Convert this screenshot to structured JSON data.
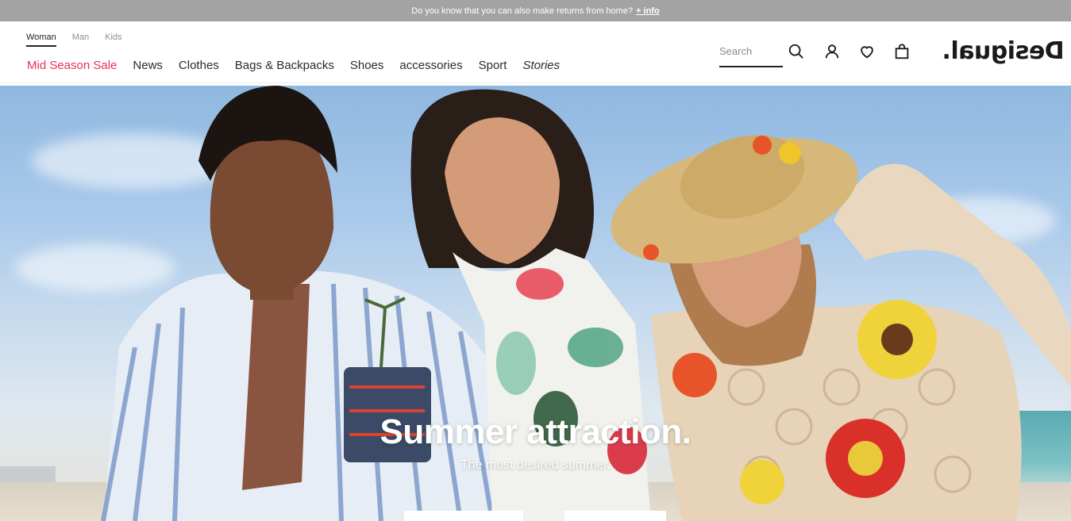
{
  "announcement": {
    "text": "Do you know that you can also make returns from home?",
    "link": "+ info"
  },
  "segments": [
    {
      "label": "Woman",
      "active": true
    },
    {
      "label": "Man",
      "active": false
    },
    {
      "label": "Kids",
      "active": false
    }
  ],
  "nav": {
    "items": [
      {
        "label": "Mid Season Sale"
      },
      {
        "label": "News"
      },
      {
        "label": "Clothes"
      },
      {
        "label": "Bags & Backpacks"
      },
      {
        "label": "Shoes"
      },
      {
        "label": "accessories"
      },
      {
        "label": "Sport"
      },
      {
        "label": "Stories"
      }
    ]
  },
  "search": {
    "placeholder": "Search"
  },
  "icons": {
    "search": "search-icon",
    "account": "user-icon",
    "wishlist": "heart-icon",
    "cart": "shopping-bag-icon"
  },
  "brand": {
    "logo": "Desigual."
  },
  "hero": {
    "title": "Summer attraction.",
    "subtitle": "The most desired summer."
  },
  "colors": {
    "sale": "#e8305a",
    "banner": "#a3a3a3",
    "text": "#222222"
  }
}
